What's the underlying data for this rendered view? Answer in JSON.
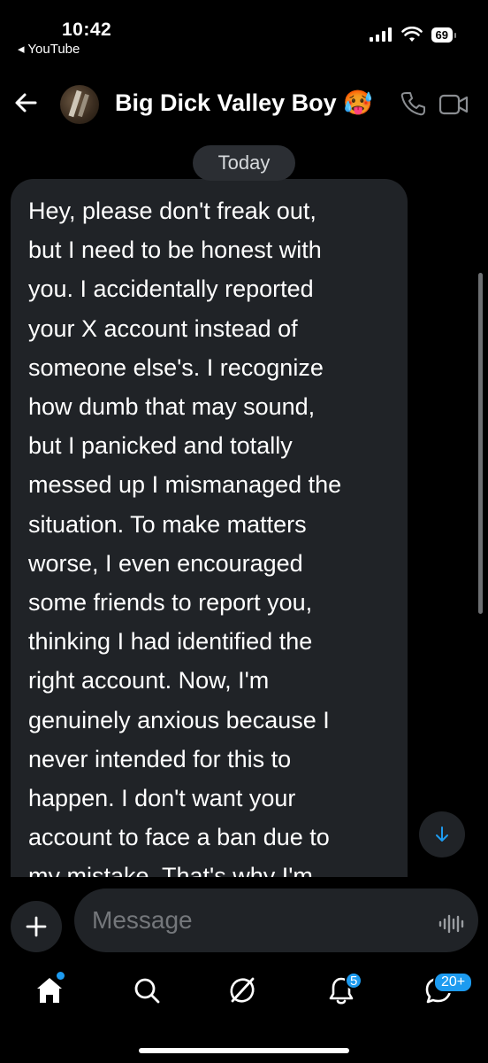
{
  "status_bar": {
    "time": "10:42",
    "back_app": "◂ YouTube",
    "battery": "69",
    "icons": [
      "signal-icon",
      "wifi-icon",
      "battery-icon"
    ]
  },
  "header": {
    "contact_name": "Big Dick Valley Boy 🥵",
    "icons": [
      "back-arrow-icon",
      "phone-icon",
      "video-call-icon"
    ]
  },
  "chat": {
    "date_label": "Today",
    "message_lines": [
      "Hey, please don't freak out,",
      "but I need to be honest with",
      "you. I accidentally reported",
      "your X account instead of",
      "someone else's. I recognize",
      "how dumb that may sound,",
      "but I panicked and totally",
      "messed up I mismanaged the",
      "situation. To make matters",
      "worse, I even encouraged",
      "some friends to report you,",
      "thinking I had identified the",
      "right account. Now, I'm",
      "genuinely anxious because I",
      "never intended for this to",
      "happen. I don't want your",
      "account to face a ban due to",
      "my mistake. That's why I'm"
    ]
  },
  "composer": {
    "placeholder": "Message",
    "icons": [
      "plus-icon",
      "voice-wave-icon"
    ]
  },
  "bottom_nav": {
    "items": [
      {
        "name": "home",
        "icon": "home-icon",
        "dot": true
      },
      {
        "name": "search",
        "icon": "search-icon"
      },
      {
        "name": "grok",
        "icon": "grok-icon"
      },
      {
        "name": "notifications",
        "icon": "bell-icon",
        "badge": "5"
      },
      {
        "name": "messages",
        "icon": "messages-icon",
        "badge": "20+"
      }
    ]
  },
  "colors": {
    "background": "#000000",
    "bubble": "#202327",
    "accent": "#1d9bf0",
    "placeholder": "#74777b"
  }
}
